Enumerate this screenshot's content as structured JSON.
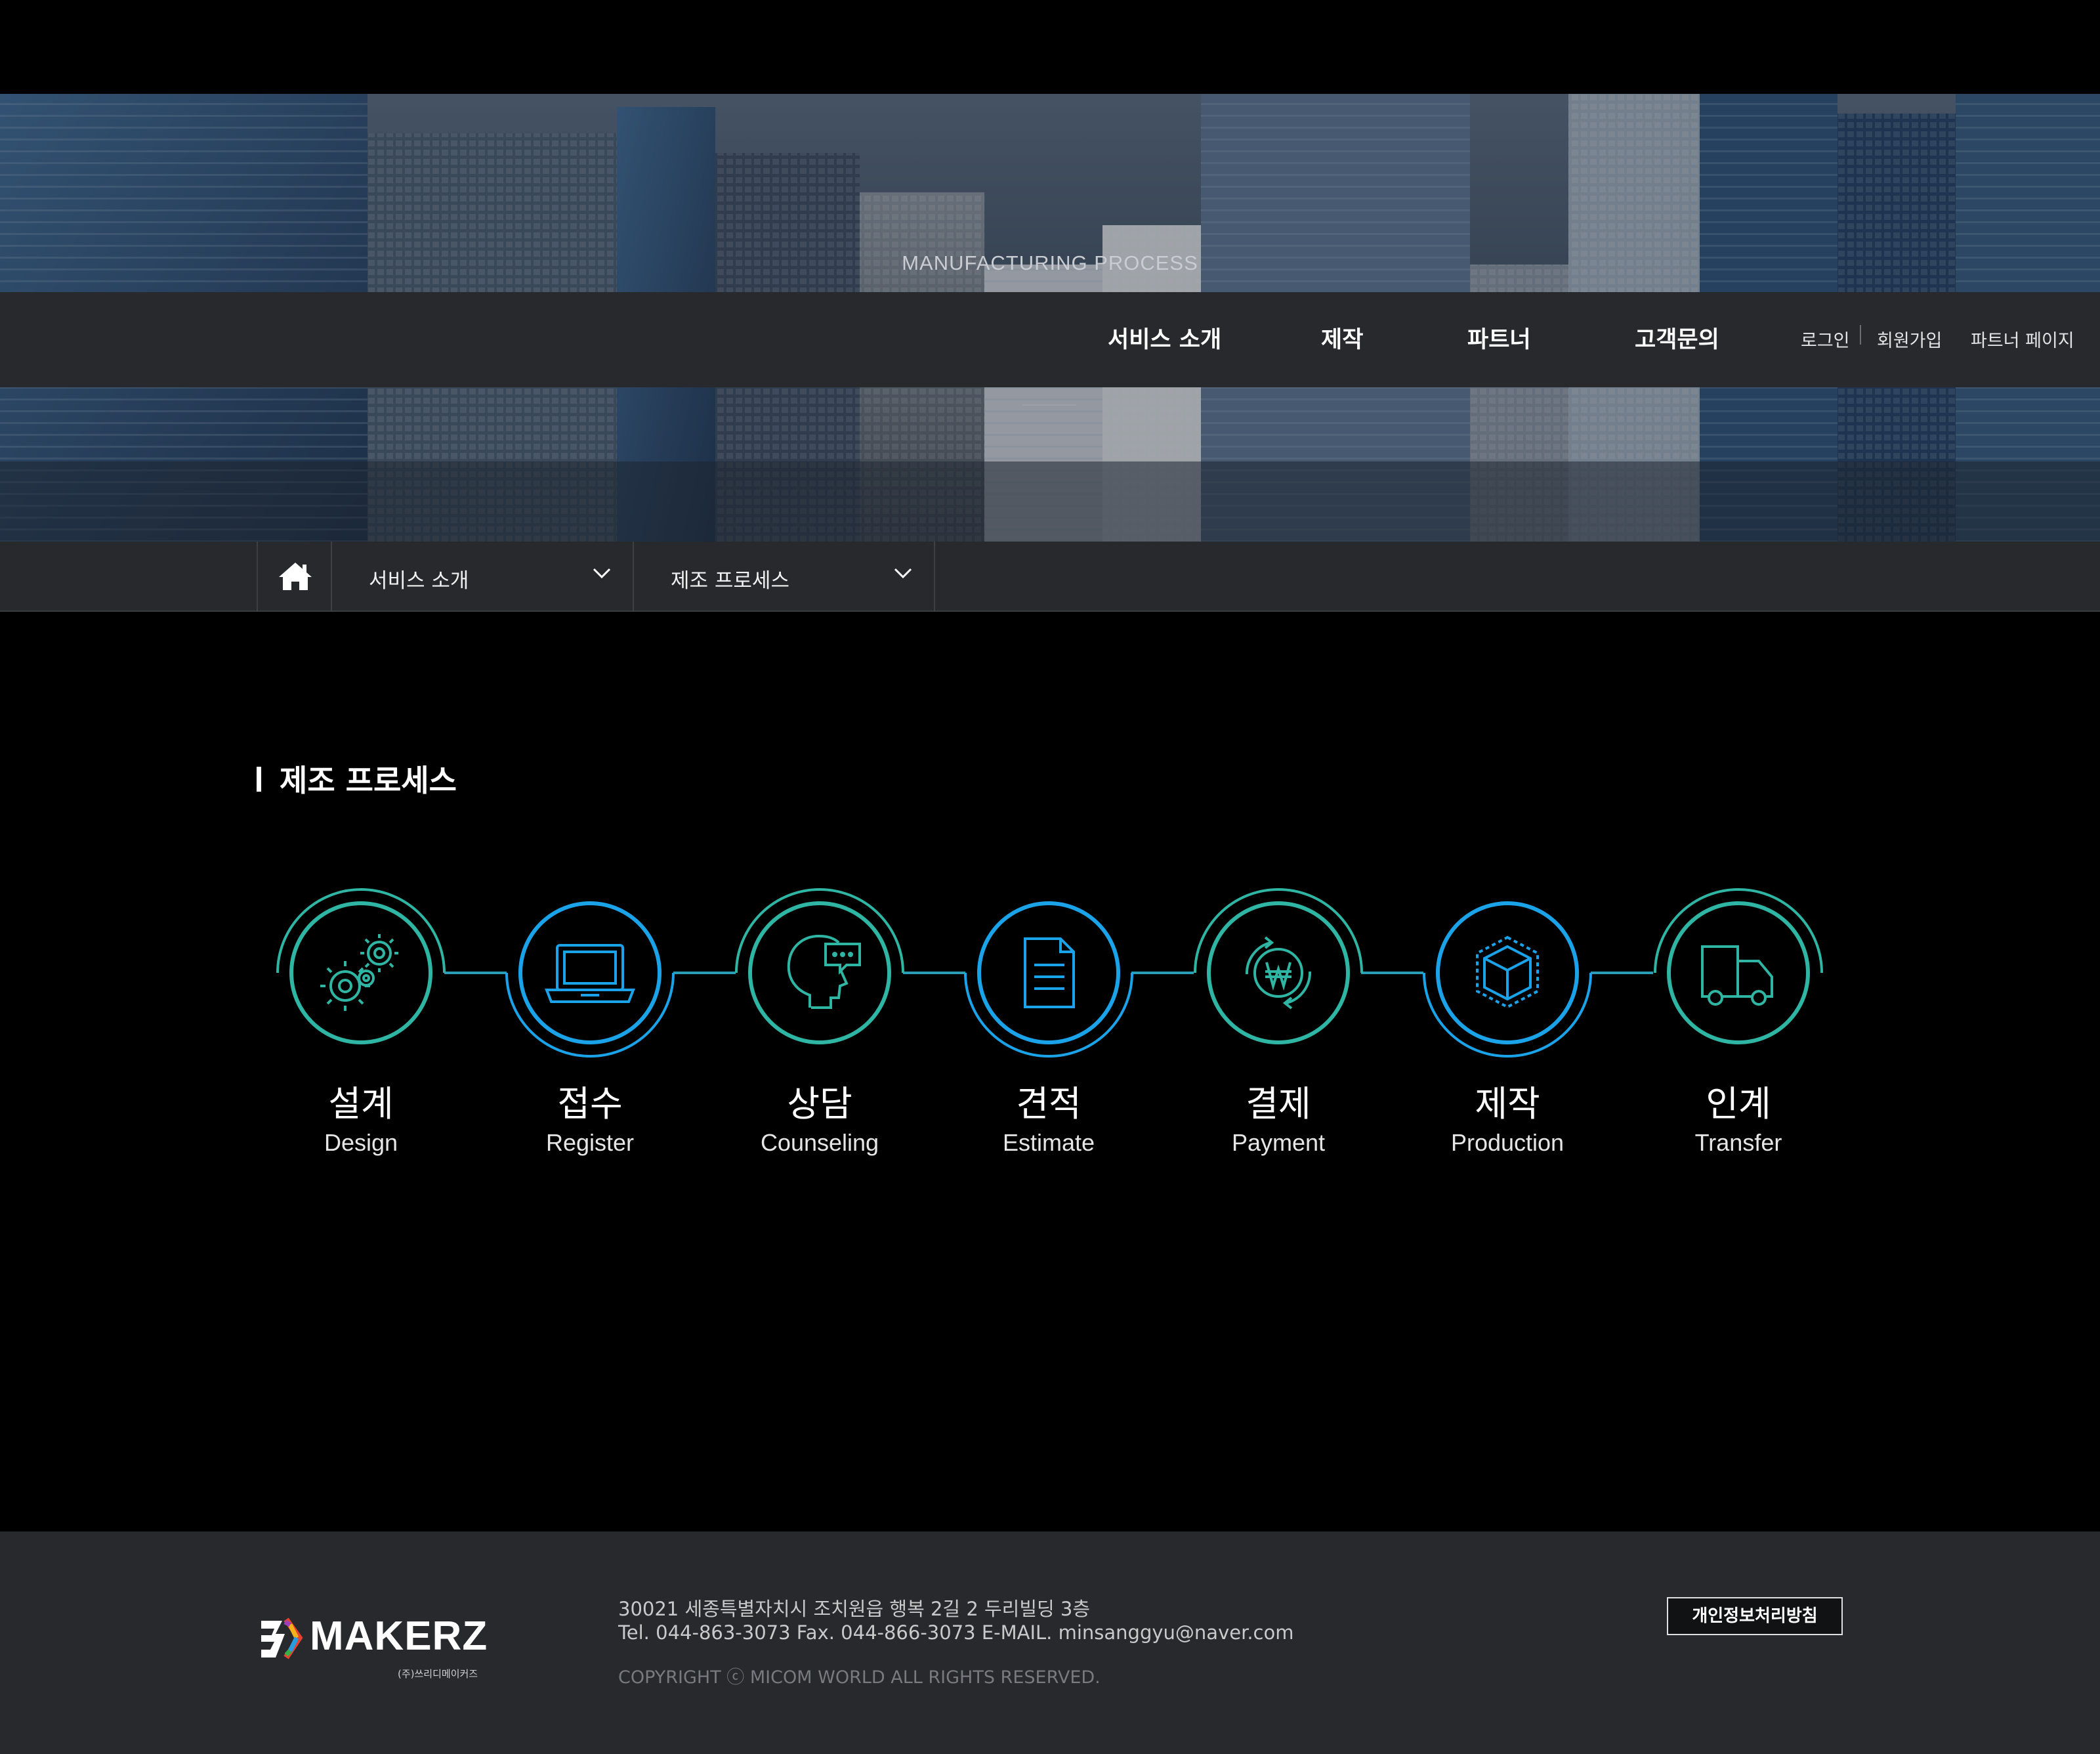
{
  "hero": {
    "title": "MANUFACTURING PROCESS"
  },
  "nav": {
    "main": [
      "서비스 소개",
      "제작",
      "파트너",
      "고객문의"
    ],
    "util": {
      "login": "로그인",
      "signup": "회원가입",
      "partner_page": "파트너 페이지"
    }
  },
  "breadcrumb": {
    "home_icon": "home-icon",
    "level1": "서비스 소개",
    "level2": "제조 프로세스"
  },
  "section": {
    "title": "제조 프로세스"
  },
  "process": {
    "steps": [
      {
        "ko": "설계",
        "en": "Design",
        "icon": "gears-icon"
      },
      {
        "ko": "접수",
        "en": "Register",
        "icon": "laptop-icon"
      },
      {
        "ko": "상담",
        "en": "Counseling",
        "icon": "head-chat-icon"
      },
      {
        "ko": "견적",
        "en": "Estimate",
        "icon": "document-icon"
      },
      {
        "ko": "결제",
        "en": "Payment",
        "icon": "won-cycle-icon"
      },
      {
        "ko": "제작",
        "en": "Production",
        "icon": "box-icon"
      },
      {
        "ko": "인계",
        "en": "Transfer",
        "icon": "truck-icon"
      }
    ],
    "colors": {
      "teal": "#2fb5a3",
      "blue": "#1aa3e8"
    }
  },
  "footer": {
    "logo_text": "MAKERZ",
    "logo_sub": "(주)쓰리디메이커즈",
    "address": "30021   세종특별자치시 조치원읍 행복 2길 2 두리빌딩 3층",
    "contact": "Tel. 044-863-3073   Fax. 044-866-3073   E-MAIL. minsanggyu@naver.com",
    "copyright": "COPYRIGHT ⓒ MICOM WORLD ALL RIGHTS RESERVED.",
    "privacy_button": "개인정보처리방침"
  }
}
